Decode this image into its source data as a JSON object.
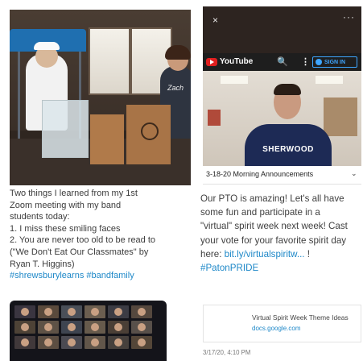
{
  "left_post": {
    "shirt_text": "Zach",
    "body_lines": [
      "Two things I learned from my 1st",
      "Zoom meeting with my band",
      "students today:",
      "1. I miss these smiling faces",
      "2. You are never too old to be read to",
      "(\"We Don't Eat Our Classmates\" by",
      "Ryan T. Higgins)"
    ],
    "hashtags": "#shrewsburylearns #bandfamily"
  },
  "right_post": {
    "close_icon": "×",
    "more_icon": "···",
    "video": {
      "platform": "YouTube",
      "search_icon": "🔍",
      "menu_icon": "⋮",
      "signin": "SIGN IN",
      "shirt_text": "SHERWOOD",
      "caption": "3-18-20 Morning Announcements",
      "chevron": "⌄"
    },
    "body_lines": [
      "Our PTO is amazing! Let's all have",
      "some fun and participate in a",
      "\"virtual\" spirit week next week! Cast",
      "your vote for your favorite spirit day"
    ],
    "here_prefix": "here: ",
    "link_text": "bit.ly/virtualspiritw...",
    "link_suffix": " !",
    "hashtag": "#PatonPRIDE",
    "card": {
      "title": "Virtual Spirit Week Theme Ideas",
      "url": "docs.google.com"
    },
    "timestamp": "3/17/20, 4:10 PM"
  },
  "colors": {
    "link_blue": "#1e88c8",
    "youtube_red": "#e01f1f",
    "header_dark": "#2d2420"
  }
}
